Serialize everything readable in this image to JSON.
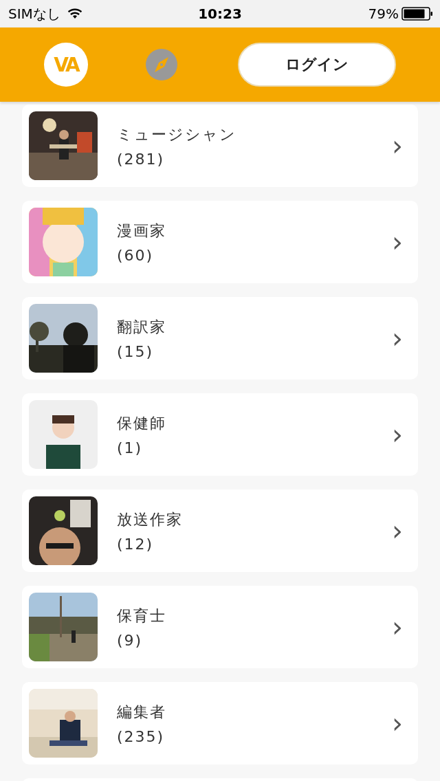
{
  "status_bar": {
    "carrier": "SIMなし",
    "time": "10:23",
    "battery": "79%"
  },
  "header": {
    "logo": "VA",
    "login_button": "ログイン"
  },
  "categories": [
    {
      "name": "ミュージシャン",
      "count": "(281)",
      "chevron": "›"
    },
    {
      "name": "漫画家",
      "count": "(60)",
      "chevron": "›"
    },
    {
      "name": "翻訳家",
      "count": "(15)",
      "chevron": "›"
    },
    {
      "name": "保健師",
      "count": "(1)",
      "chevron": "›"
    },
    {
      "name": "放送作家",
      "count": "(12)",
      "chevron": "›"
    },
    {
      "name": "保育士",
      "count": "(9)",
      "chevron": "›"
    },
    {
      "name": "編集者",
      "count": "(235)",
      "chevron": "›"
    }
  ]
}
